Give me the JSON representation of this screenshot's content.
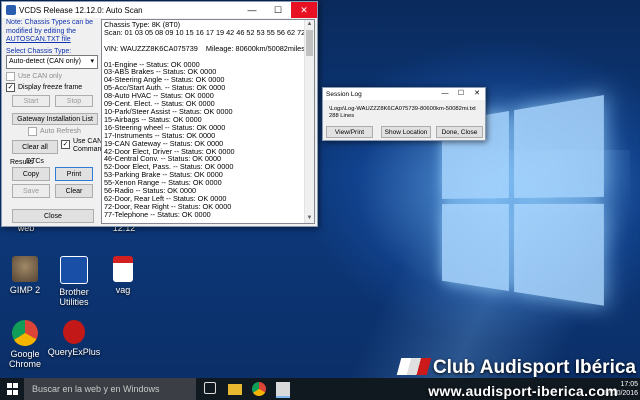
{
  "desktop": {
    "icons": [
      {
        "label": "GIMP 2"
      },
      {
        "label": "Brother Utilities"
      },
      {
        "label": "vag"
      },
      {
        "label": "Google Chrome"
      },
      {
        "label": "QueryExPlus"
      }
    ],
    "partial_labels": [
      "web",
      "12.12"
    ]
  },
  "vcds": {
    "title": "VCDS Release 12.12.0:  Auto Scan",
    "note": "Note:  Chassis Types can be modified by editing the",
    "note_link": "AUTOSCAN.TXT file",
    "chassis_label": "Select Chassis Type:",
    "chassis_value": "Auto-detect (CAN only)",
    "use_can_only": "Use CAN only",
    "display_freeze": "Display freeze frame",
    "start": "Start",
    "stop": "Stop",
    "gateway": "Gateway Installation List",
    "auto_refresh": "Auto Refresh",
    "clear_dtcs": "Clear all DTCs",
    "use_can_command": "Use CAN Command",
    "results_label": "Results",
    "copy": "Copy",
    "print": "Print",
    "save": "Save",
    "clear": "Clear",
    "close": "Close",
    "scan_text": "Chassis Type: 8K (8T0)\nScan: 01 03 05 08 09 10 15 16 17 19 42 46 52 53 55 56 62 72 77\n\nVIN: WAUZZZ8K6CA075739    Mileage: 80600km/50082miles\n\n01-Engine -- Status: OK 0000\n03-ABS Brakes -- Status: OK 0000\n04-Steering Angle -- Status: OK 0000\n05-Acc/Start Auth. -- Status: OK 0000\n08-Auto HVAC -- Status: OK 0000\n09-Cent. Elect. -- Status: OK 0000\n10-Park/Steer Assist -- Status: OK 0000\n15-Airbags -- Status: OK 0000\n16-Steering wheel -- Status: OK 0000\n17-Instruments -- Status: OK 0000\n19-CAN Gateway -- Status: OK 0000\n42-Door Elect, Driver -- Status: OK 0000\n46-Central Conv. -- Status: OK 0000\n52-Door Elect, Pass. -- Status: OK 0000\n53-Parking Brake -- Status: OK 0000\n55-Xenon Range -- Status: OK 0000\n56-Radio -- Status: OK 0000\n62-Door, Rear Left -- Status: OK 0000\n72-Door, Rear Right -- Status: OK 0000\n77-Telephone -- Status: OK 0000"
  },
  "session_log": {
    "title": "Session Log",
    "path": "\\Logs\\Log-WAUZZZ8K6CA075739-80600km-50082mi.txt",
    "lines": "288 Lines",
    "view_print": "View/Print",
    "show_location": "Show Location",
    "done_close": "Done, Close"
  },
  "taskbar": {
    "search_placeholder": "Buscar en la web y en Windows",
    "time": "17:05",
    "date": "17/10/2016"
  },
  "watermark": {
    "brand": "Club Audisport Ibérica",
    "url": "www.audisport-iberica.com"
  }
}
